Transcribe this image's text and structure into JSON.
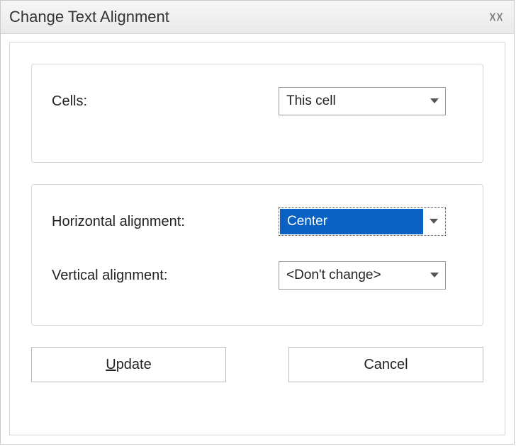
{
  "title": "Change Text Alignment",
  "group1": {
    "cells_label": "Cells:",
    "cells_value": "This cell"
  },
  "group2": {
    "h_label": "Horizontal alignment:",
    "h_value": "Center",
    "v_label": "Vertical alignment:",
    "v_value": "<Don't change>"
  },
  "buttons": {
    "update_prefix": "U",
    "update_rest": "pdate",
    "cancel": "Cancel"
  }
}
